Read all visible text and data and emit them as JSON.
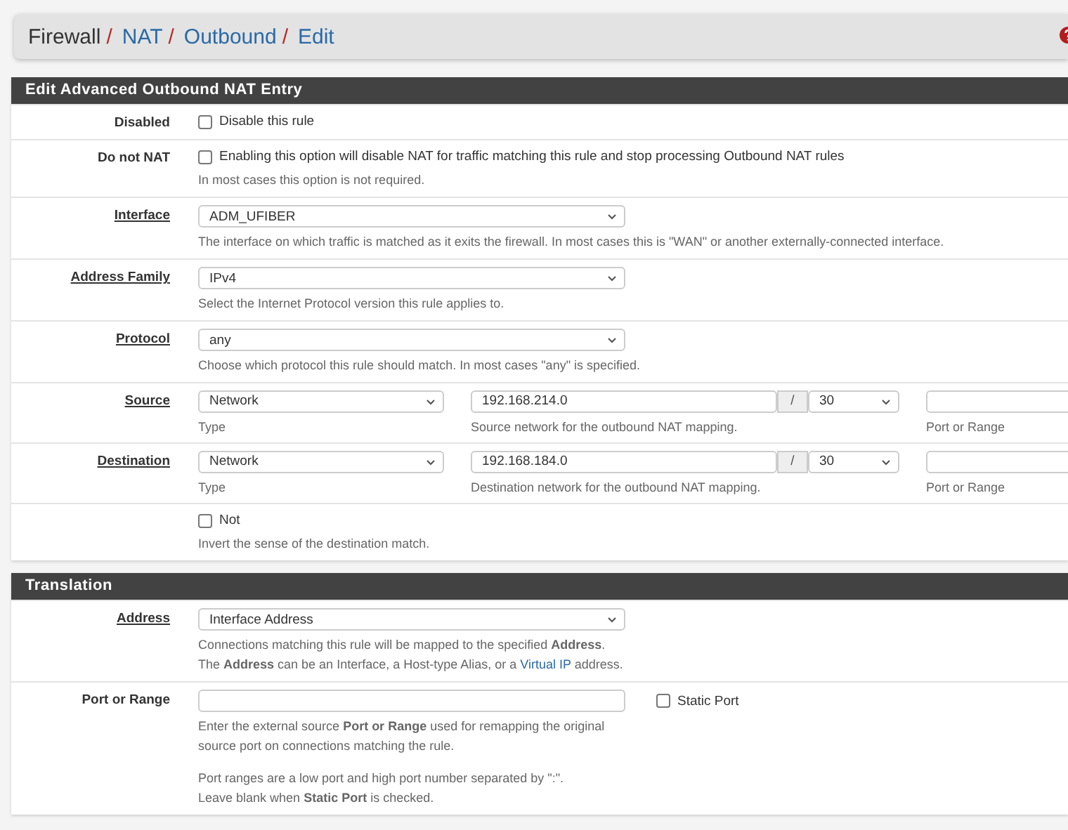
{
  "separator": "/",
  "breadcrumb": [
    {
      "text": "Firewall",
      "kind": "plain"
    },
    {
      "text": "NAT",
      "kind": "link"
    },
    {
      "text": "Outbound",
      "kind": "link"
    },
    {
      "text": "Edit",
      "kind": "link"
    }
  ],
  "sections": [
    {
      "title": "Edit Advanced Outbound NAT Entry",
      "rows": [
        {
          "kind": "checkbox",
          "label": "Disabled",
          "link": false,
          "checkbox": {
            "label": "Disable this rule",
            "checked": false
          },
          "help": []
        },
        {
          "kind": "checkbox",
          "label": "Do not NAT",
          "link": false,
          "checkbox": {
            "label": "Enabling this option will disable NAT for traffic matching this rule and stop processing Outbound NAT rules",
            "checked": false
          },
          "help": [
            [
              [
                "In most cases this option is not required."
              ]
            ]
          ]
        },
        {
          "kind": "select",
          "label": "Interface",
          "link": true,
          "value": "ADM_UFIBER",
          "help": [
            [
              [
                "The interface on which traffic is matched as it exits the firewall. In most cases this is \"WAN\" or another externally-connected interface."
              ]
            ]
          ]
        },
        {
          "kind": "select",
          "label": "Address Family",
          "link": true,
          "value": "IPv4",
          "help": [
            [
              [
                "Select the Internet Protocol version this rule applies to."
              ]
            ]
          ]
        },
        {
          "kind": "select",
          "label": "Protocol",
          "link": true,
          "value": "any",
          "help": [
            [
              [
                "Choose which protocol this rule should match. In most cases \"any\" is specified."
              ]
            ]
          ]
        },
        {
          "kind": "network",
          "label": "Source",
          "link": true,
          "type": "Network",
          "type_caption": "Type",
          "address": "192.168.214.0",
          "slash": "/",
          "mask": "30",
          "address_caption": "Source network for the outbound NAT mapping.",
          "port_caption": "Port or Range"
        },
        {
          "kind": "network",
          "label": "Destination",
          "link": true,
          "type": "Network",
          "type_caption": "Type",
          "address": "192.168.184.0",
          "slash": "/",
          "mask": "30",
          "address_caption": "Destination network for the outbound NAT mapping.",
          "port_caption": "Port or Range"
        },
        {
          "kind": "checkbox",
          "checkbox": {
            "label": "Not",
            "checked": false
          },
          "help": [
            [
              [
                "Invert the sense of the destination match."
              ]
            ]
          ]
        }
      ]
    },
    {
      "title": "Translation",
      "rows": [
        {
          "kind": "select",
          "label": "Address",
          "link": true,
          "value": "Interface Address",
          "help": [
            [
              [
                "Connections matching this rule will be mapped to the specified **Address**."
              ],
              [
                "The **Address** can be an Interface, a Host-type Alias, or a ",
                {
                  "link": "Virtual IP"
                },
                " address."
              ]
            ]
          ]
        },
        {
          "kind": "input",
          "label": "Port or Range",
          "link": false,
          "side_checkbox": {
            "label": "Static Port",
            "checked": false
          },
          "help": [
            [
              [
                "Enter the external source **Port or Range** used for remapping the original source port on connections matching the rule."
              ]
            ],
            [
              [
                "Port ranges are a low port and high port number separated by \":\"."
              ],
              [
                "Leave blank when **Static Port** is checked."
              ]
            ]
          ]
        }
      ]
    }
  ]
}
